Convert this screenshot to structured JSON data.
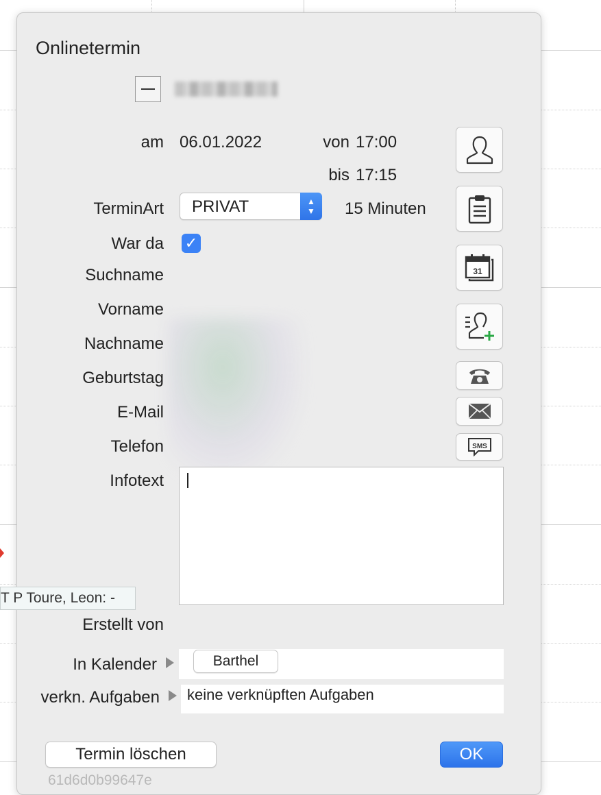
{
  "dialog": {
    "title": "Onlinetermin",
    "date_label": "am",
    "date_value": "06.01.2022",
    "from_label": "von",
    "from_value": "17:00",
    "to_label": "bis",
    "to_value": "17:15",
    "type_label": "TerminArt",
    "type_selected": "PRIVAT",
    "duration": "15 Minuten",
    "attended_label": "War da",
    "attended_checked": true,
    "fields": {
      "suchname": "Suchname",
      "vorname": "Vorname",
      "nachname": "Nachname",
      "geburtstag": "Geburtstag",
      "email": "E-Mail",
      "telefon": "Telefon",
      "infotext": "Infotext",
      "erstellt_von": "Erstellt von"
    },
    "calendar_label": "In Kalender",
    "calendar_value": "Barthel",
    "tasks_label": "verkn. Aufgaben",
    "tasks_value": "keine verknüpften Aufgaben",
    "delete_label": "Termin löschen",
    "ok_label": "OK",
    "footer_id": "61d6d0b99647e",
    "calendar_icon_day": "31",
    "sms_icon_text": "SMS"
  },
  "tooltip": {
    "text": "T P Toure, Leon: -"
  },
  "icons": {
    "person": "person-icon",
    "clipboard": "clipboard-icon",
    "calendar": "calendar-icon",
    "add_contact": "add-contact-icon",
    "phone": "phone-icon",
    "mail": "mail-icon",
    "sms": "sms-icon"
  },
  "colors": {
    "accent": "#3b82f6",
    "panel_bg": "#ececec",
    "add_green": "#2aa845"
  }
}
